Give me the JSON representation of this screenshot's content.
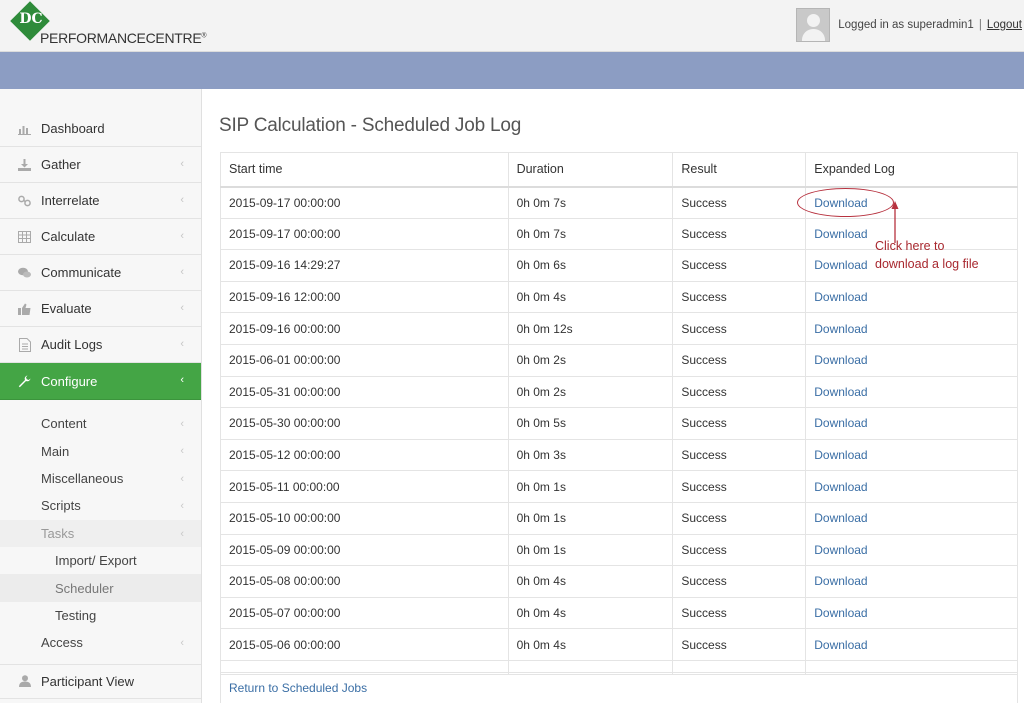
{
  "header": {
    "logo_initials": "DC",
    "logo_text": "PERFORMANCECENTRE",
    "logo_reg": "®",
    "logged_in_text": "Logged in as superadmin1",
    "separator": "|",
    "logout_label": "Logout"
  },
  "sidebar": {
    "items": [
      {
        "label": "Dashboard",
        "icon": "bar-chart-icon"
      },
      {
        "label": "Gather",
        "icon": "download-icon"
      },
      {
        "label": "Interrelate",
        "icon": "link-icon"
      },
      {
        "label": "Calculate",
        "icon": "table-icon"
      },
      {
        "label": "Communicate",
        "icon": "comments-icon"
      },
      {
        "label": "Evaluate",
        "icon": "thumbs-up-icon"
      },
      {
        "label": "Audit Logs",
        "icon": "document-icon"
      },
      {
        "label": "Configure",
        "icon": "wrench-icon"
      }
    ],
    "sub_items": [
      "Content",
      "Main",
      "Miscellaneous",
      "Scripts",
      "Tasks"
    ],
    "task_items": [
      "Import/ Export",
      "Scheduler",
      "Testing"
    ],
    "access_label": "Access",
    "participant_view_label": "Participant View"
  },
  "main": {
    "title": "SIP Calculation - Scheduled Job Log",
    "columns": [
      "Start time",
      "Duration",
      "Result",
      "Expanded Log"
    ],
    "rows": [
      {
        "start": "2015-09-17 00:00:00",
        "duration": "0h 0m 7s",
        "result": "Success",
        "log": "Download"
      },
      {
        "start": "2015-09-17 00:00:00",
        "duration": "0h 0m 7s",
        "result": "Success",
        "log": "Download"
      },
      {
        "start": "2015-09-16 14:29:27",
        "duration": "0h 0m 6s",
        "result": "Success",
        "log": "Download"
      },
      {
        "start": "2015-09-16 12:00:00",
        "duration": "0h 0m 4s",
        "result": "Success",
        "log": "Download"
      },
      {
        "start": "2015-09-16 00:00:00",
        "duration": "0h 0m 12s",
        "result": "Success",
        "log": "Download"
      },
      {
        "start": "2015-06-01 00:00:00",
        "duration": "0h 0m 2s",
        "result": "Success",
        "log": "Download"
      },
      {
        "start": "2015-05-31 00:00:00",
        "duration": "0h 0m 2s",
        "result": "Success",
        "log": "Download"
      },
      {
        "start": "2015-05-30 00:00:00",
        "duration": "0h 0m 5s",
        "result": "Success",
        "log": "Download"
      },
      {
        "start": "2015-05-12 00:00:00",
        "duration": "0h 0m 3s",
        "result": "Success",
        "log": "Download"
      },
      {
        "start": "2015-05-11 00:00:00",
        "duration": "0h 0m 1s",
        "result": "Success",
        "log": "Download"
      },
      {
        "start": "2015-05-10 00:00:00",
        "duration": "0h 0m 1s",
        "result": "Success",
        "log": "Download"
      },
      {
        "start": "2015-05-09 00:00:00",
        "duration": "0h 0m 1s",
        "result": "Success",
        "log": "Download"
      },
      {
        "start": "2015-05-08 00:00:00",
        "duration": "0h 0m 4s",
        "result": "Success",
        "log": "Download"
      },
      {
        "start": "2015-05-07 00:00:00",
        "duration": "0h 0m 4s",
        "result": "Success",
        "log": "Download"
      },
      {
        "start": "2015-05-06 00:00:00",
        "duration": "0h 0m 4s",
        "result": "Success",
        "log": "Download"
      }
    ],
    "return_link": "Return to Scheduled Jobs"
  },
  "annotation": {
    "line1": "Click here to",
    "line2": "download a log file"
  },
  "colors": {
    "accent_green": "#44a545",
    "header_blue": "#8c9dc3",
    "link_blue": "#3a6ea5",
    "annotation_red": "#a8282f"
  }
}
